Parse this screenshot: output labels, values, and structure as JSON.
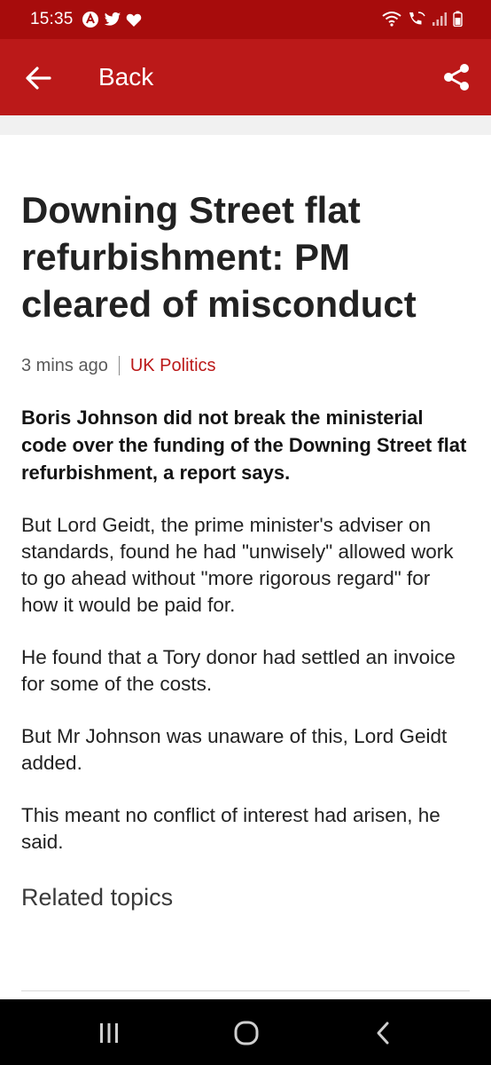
{
  "status_bar": {
    "time": "15:35",
    "notification_icons": [
      "app-notification-icon",
      "twitter-icon",
      "heart-icon"
    ],
    "system_icons": [
      "wifi-icon",
      "wifi-calling-icon",
      "signal-icon",
      "battery-icon"
    ]
  },
  "app_bar": {
    "back_label": "Back",
    "back_icon": "arrow-left-icon",
    "share_icon": "share-icon",
    "background_color": "#bb1919"
  },
  "article": {
    "headline": "Downing Street flat refurbishment: PM cleared of misconduct",
    "timestamp": "3 mins ago",
    "topic": "UK Politics",
    "intro": "Boris Johnson did not break the ministerial code over the funding of the Downing Street flat refurbishment, a report says.",
    "paragraphs": [
      "But Lord Geidt, the prime minister's adviser on standards, found he had \"unwisely\" allowed work to go ahead without \"more rigorous regard\" for how it would be paid for.",
      "He found that a Tory donor had settled an invoice for some of the costs.",
      "But Mr Johnson was unaware of this, Lord Geidt added.",
      "This meant no conflict of interest had arisen, he said."
    ],
    "related_heading": "Related topics"
  },
  "nav_bar": {
    "recents_icon": "recent-apps-icon",
    "home_icon": "home-icon",
    "back_icon": "system-back-icon"
  }
}
